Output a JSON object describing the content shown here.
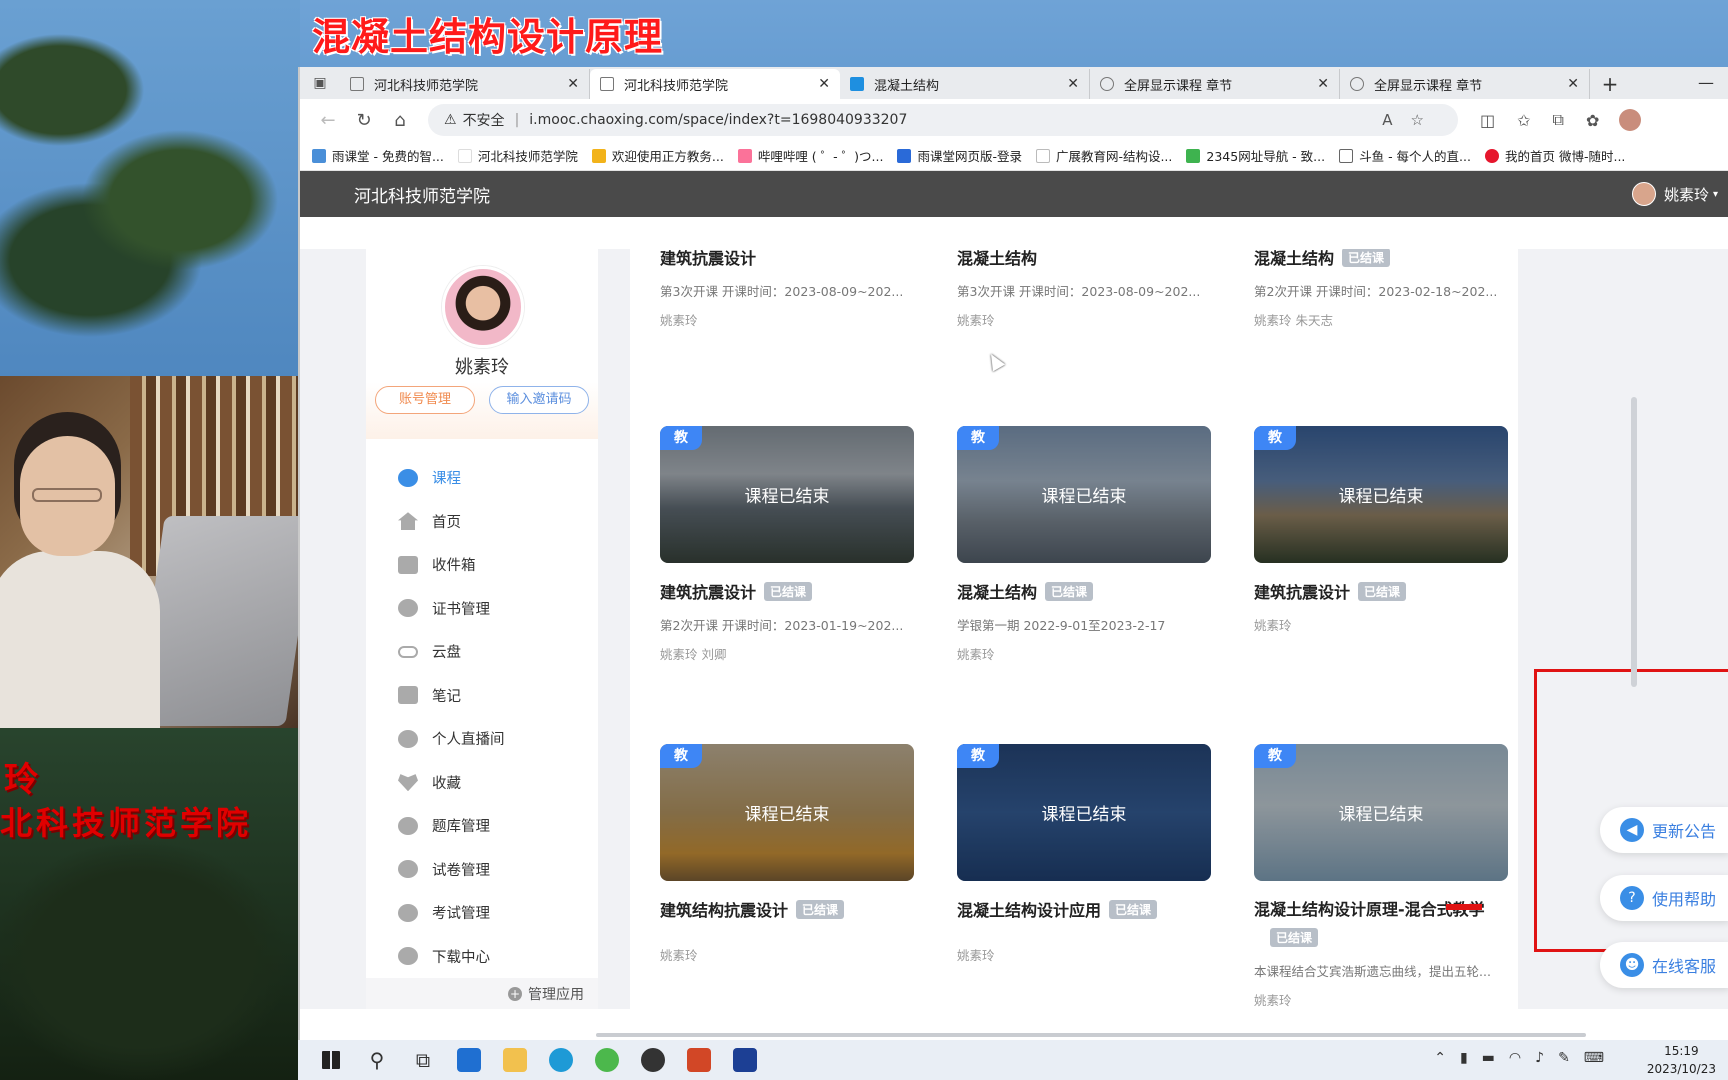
{
  "overlay": {
    "video_title": "混凝土结构设计原理",
    "name_partial": "玲",
    "school_partial": "北科技师范学院"
  },
  "browser": {
    "tabs": [
      {
        "label": "河北科技师范学院",
        "active": false,
        "icon": "page-icon"
      },
      {
        "label": "河北科技师范学院",
        "active": true,
        "icon": "page-icon"
      },
      {
        "label": "混凝土结构",
        "active": false,
        "icon": "x-logo-icon"
      },
      {
        "label": "全屏显示课程 章节",
        "active": false,
        "icon": "globe-icon"
      },
      {
        "label": "全屏显示课程 章节",
        "active": false,
        "icon": "globe-icon"
      }
    ],
    "address": {
      "insecure_label": "不安全",
      "url": "i.mooc.chaoxing.com/space/index?t=1698040933207"
    },
    "bookmarks": [
      "雨课堂 - 免费的智...",
      "河北科技师范学院",
      "欢迎使用正方教务...",
      "哔哩哔哩 ( ゜- ゜)つ...",
      "雨课堂网页版-登录",
      "广展教育网-结构设...",
      "2345网址导航 - 致...",
      "斗鱼 - 每个人的直...",
      "我的首页 微博-随时..."
    ]
  },
  "site": {
    "header_title": "河北科技师范学院",
    "user_name": "姚素玲"
  },
  "profile": {
    "name": "姚素玲",
    "account_button": "账号管理",
    "invite_button": "输入邀请码"
  },
  "menu": [
    {
      "label": "课程",
      "icon": "course-icon",
      "active": true
    },
    {
      "label": "首页",
      "icon": "home-icon",
      "active": false
    },
    {
      "label": "收件箱",
      "icon": "inbox-icon",
      "active": false
    },
    {
      "label": "证书管理",
      "icon": "certificate-icon",
      "active": false
    },
    {
      "label": "云盘",
      "icon": "cloud-icon",
      "active": false
    },
    {
      "label": "笔记",
      "icon": "note-icon",
      "active": false
    },
    {
      "label": "个人直播间",
      "icon": "live-icon",
      "active": false
    },
    {
      "label": "收藏",
      "icon": "heart-icon",
      "active": false
    },
    {
      "label": "题库管理",
      "icon": "question-bank-icon",
      "active": false
    },
    {
      "label": "试卷管理",
      "icon": "paper-icon",
      "active": false
    },
    {
      "label": "考试管理",
      "icon": "exam-icon",
      "active": false
    },
    {
      "label": "下载中心",
      "icon": "download-icon",
      "active": false
    },
    {
      "label": "云盘",
      "icon": "cloud-icon",
      "active": false
    }
  ],
  "manage_apps": "管理应用",
  "courses": {
    "teach_tag": "教",
    "ended_overlay": "课程已结束",
    "ended_badge": "已结课",
    "row1": [
      {
        "title": "建筑抗震设计",
        "meta": "第3次开课   开课时间：2023-08-09~202...",
        "teacher": "姚素玲",
        "badge": false
      },
      {
        "title": "混凝土结构",
        "meta": "第3次开课   开课时间：2023-08-09~202...",
        "teacher": "姚素玲",
        "badge": false
      },
      {
        "title": "混凝土结构",
        "meta": "第2次开课   开课时间：2023-02-18~202...",
        "teacher": "姚素玲  朱天志",
        "badge": true
      }
    ],
    "row2": [
      {
        "title": "建筑抗震设计",
        "meta": "第2次开课   开课时间：2023-01-19~202...",
        "teacher": "姚素玲  刘卿",
        "badge": true
      },
      {
        "title": "混凝土结构",
        "meta": "学银第一期 2022-9-01至2023-2-17",
        "teacher": "姚素玲",
        "badge": true
      },
      {
        "title": "建筑抗震设计",
        "meta": "",
        "teacher": "姚素玲",
        "badge": true
      }
    ],
    "row3": [
      {
        "title": "建筑结构抗震设计",
        "meta": "",
        "teacher": "姚素玲",
        "badge": true
      },
      {
        "title": "混凝土结构设计应用",
        "meta": "",
        "teacher": "姚素玲",
        "badge": true
      },
      {
        "title": "混凝土结构设计原理-混合式教学",
        "meta": "本课程结合艾宾浩斯遗忘曲线，提出五轮...",
        "teacher": "姚素玲",
        "badge": true
      }
    ]
  },
  "float": {
    "notice": "更新公告",
    "help": "使用帮助",
    "service": "在线客服"
  },
  "taskbar": {
    "time": "15:19",
    "date": "2023/10/23"
  },
  "colors": {
    "accent": "#3a8ee6",
    "highlight_box": "#e01313",
    "header_bg": "#4a4a4a"
  }
}
